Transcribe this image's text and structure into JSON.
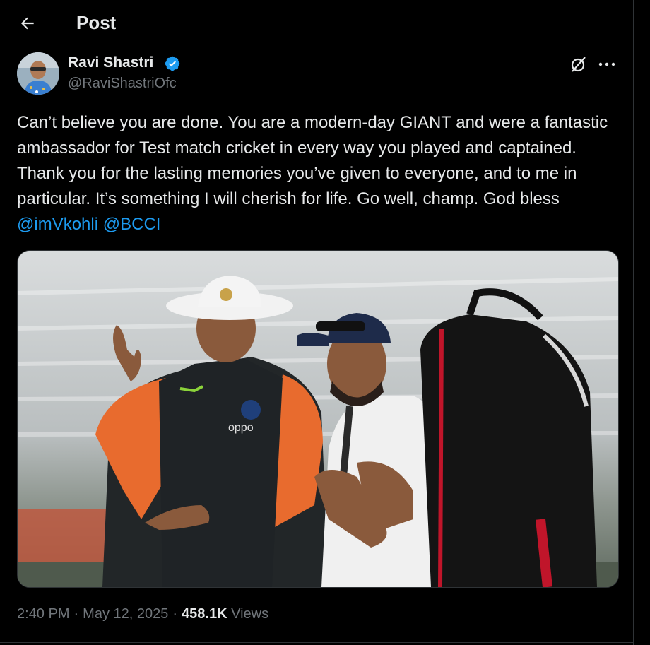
{
  "header": {
    "title": "Post"
  },
  "author": {
    "name": "Ravi Shastri",
    "handle": "@RaviShastriOfc",
    "verified": true
  },
  "tweet": {
    "text": "Can’t believe you are done. You are a modern-day GIANT and were a fantastic ambassador for Test match cricket in every way you played and captained. Thank you for the lasting memories you’ve given to everyone, and to me in particular. It’s something I will cherish for life. Go well, champ. God bless ",
    "mentions": [
      "@imVkohli",
      "@BCCI"
    ]
  },
  "media": {
    "cap_logo_text": "oppo"
  },
  "meta": {
    "time": "2:40 PM",
    "date": "May 12, 2025",
    "separator": "·",
    "views_count": "458.1K",
    "views_label": "Views"
  },
  "icons": {
    "back": "back-arrow-icon",
    "verified": "verified-badge-icon",
    "grok": "grok-icon",
    "more": "more-icon"
  },
  "colors": {
    "background": "#000000",
    "text": "#e7e9ea",
    "secondary": "#71767b",
    "link": "#1d9bf0",
    "verified": "#1d9bf0",
    "divider": "#2f3336"
  }
}
